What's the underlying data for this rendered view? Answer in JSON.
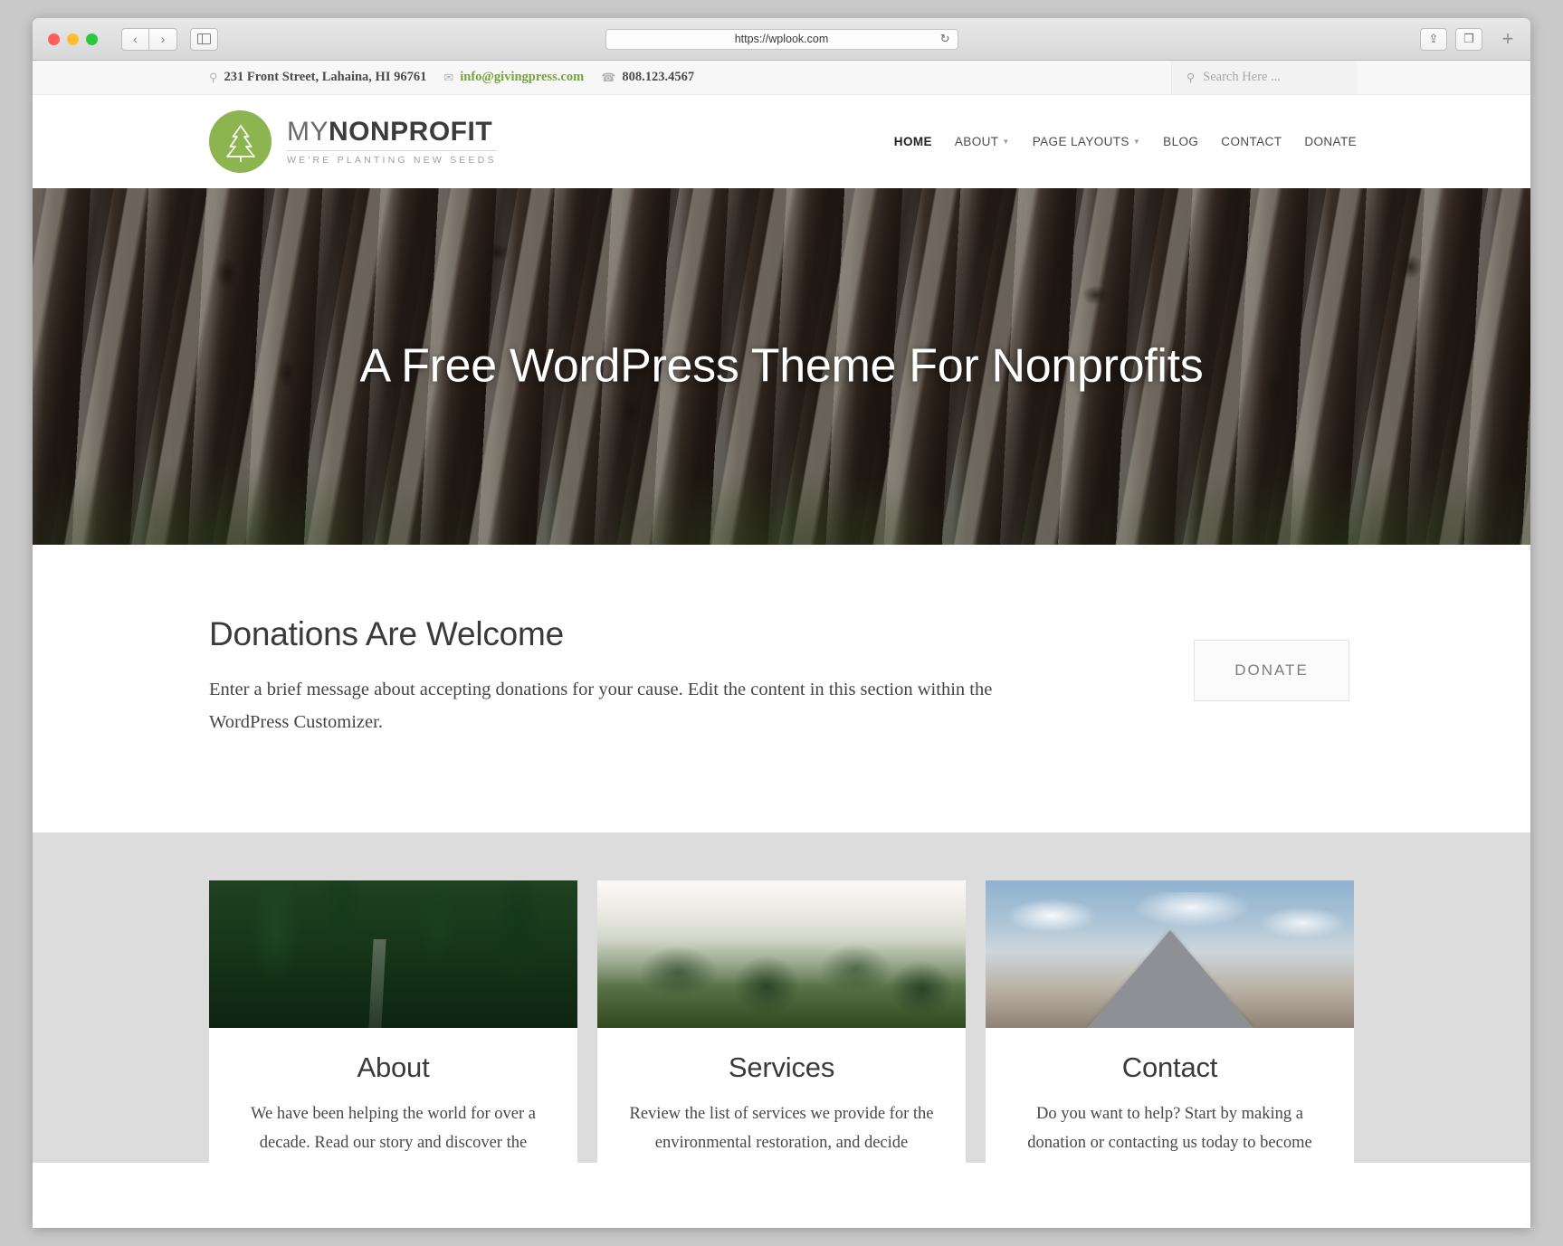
{
  "browser": {
    "url": "https://wplook.com",
    "reload_icon": "reload-icon",
    "back_icon": "chevron-left-icon",
    "forward_icon": "chevron-right-icon",
    "sidebar_icon": "sidebar-toggle-icon",
    "share_icon": "share-icon",
    "tabs_icon": "show-tabs-icon",
    "new_tab_icon": "plus-icon"
  },
  "topbar": {
    "address": "231 Front Street, Lahaina, HI 96761",
    "email": "info@givingpress.com",
    "phone": "808.123.4567",
    "location_icon": "map-pin-icon",
    "email_icon": "envelope-icon",
    "phone_icon": "phone-icon",
    "search_icon": "search-icon",
    "search_placeholder": "Search Here ...",
    "search_value": ""
  },
  "brand": {
    "name_light": "MY",
    "name_bold": "NONPROFIT",
    "tagline": "WE'RE PLANTING NEW SEEDS",
    "logo_icon": "pine-tree-icon",
    "accent_color": "#8cb44f"
  },
  "nav": {
    "items": [
      {
        "label": "HOME",
        "active": true,
        "dropdown": false
      },
      {
        "label": "ABOUT",
        "active": false,
        "dropdown": true
      },
      {
        "label": "PAGE LAYOUTS",
        "active": false,
        "dropdown": true
      },
      {
        "label": "BLOG",
        "active": false,
        "dropdown": false
      },
      {
        "label": "CONTACT",
        "active": false,
        "dropdown": false
      },
      {
        "label": "DONATE",
        "active": false,
        "dropdown": false
      }
    ]
  },
  "hero": {
    "title": "A Free WordPress Theme For Nonprofits"
  },
  "donation": {
    "title": "Donations Are Welcome",
    "text": "Enter a brief message about accepting donations for your cause. Edit the content in this section within the WordPress Customizer.",
    "button_label": "DONATE"
  },
  "cards": [
    {
      "title": "About",
      "text": "We have been helping the world for over a decade. Read our story and discover the",
      "image": "forest-road-image"
    },
    {
      "title": "Services",
      "text": "Review the list of services we provide for the environmental restoration, and decide",
      "image": "foggy-forest-image"
    },
    {
      "title": "Contact",
      "text": "Do you want to help? Start by making a donation or contacting us today to become",
      "image": "snowy-mountain-image"
    }
  ]
}
